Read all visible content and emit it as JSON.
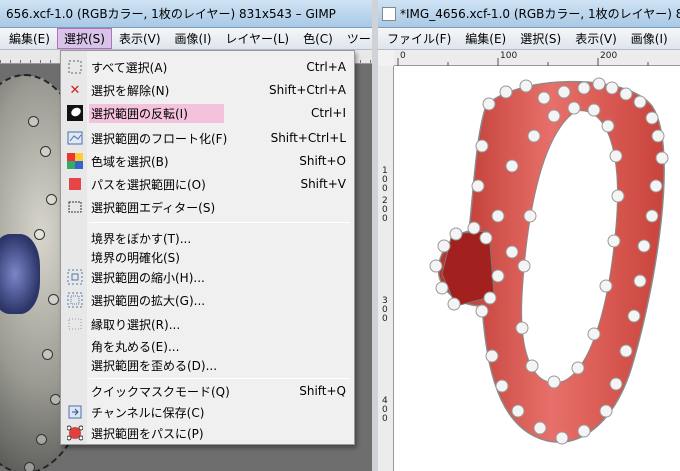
{
  "left_window": {
    "title": "656.xcf-1.0 (RGBカラー, 1枚のレイヤー) 831x543 – GIMP",
    "menubar": [
      "編集(E)",
      "選択(S)",
      "表示(V)",
      "画像(I)",
      "レイヤー(L)",
      "色(C)",
      "ツー"
    ],
    "active_menu": "選択(S)",
    "dropdown": [
      {
        "label": "すべて選択(A)",
        "shortcut": "Ctrl+A",
        "icon": "select-all-icon"
      },
      {
        "label": "選択を解除(N)",
        "shortcut": "Shift+Ctrl+A",
        "icon": "select-none-icon"
      },
      {
        "label": "選択範囲の反転(I)",
        "shortcut": "Ctrl+I",
        "icon": "invert-selection-icon",
        "highlighted": true
      },
      {
        "label": "選択範囲のフロート化(F)",
        "shortcut": "Shift+Ctrl+L",
        "icon": "float-selection-icon"
      },
      {
        "label": "色域を選択(B)",
        "shortcut": "Shift+O",
        "icon": "select-by-color-icon"
      },
      {
        "label": "パスを選択範囲に(O)",
        "shortcut": "Shift+V",
        "icon": "path-to-selection-icon"
      },
      {
        "label": "選択範囲エディター(S)",
        "shortcut": "",
        "icon": "selection-editor-icon"
      },
      {
        "label": "境界をぼかす(T)...",
        "shortcut": "",
        "icon": ""
      },
      {
        "label": "境界の明確化(S)",
        "shortcut": "",
        "icon": ""
      },
      {
        "label": "選択範囲の縮小(H)...",
        "shortcut": "",
        "icon": "shrink-selection-icon"
      },
      {
        "label": "選択範囲の拡大(G)...",
        "shortcut": "",
        "icon": "grow-selection-icon"
      },
      {
        "label": "縁取り選択(R)...",
        "shortcut": "",
        "icon": "border-selection-icon"
      },
      {
        "label": "角を丸める(E)...",
        "shortcut": "",
        "icon": ""
      },
      {
        "label": "選択範囲を歪める(D)...",
        "shortcut": "",
        "icon": ""
      },
      {
        "label": "クイックマスクモード(Q)",
        "shortcut": "Shift+Q",
        "icon": ""
      },
      {
        "label": "チャンネルに保存(C)",
        "shortcut": "",
        "icon": "save-to-channel-icon"
      },
      {
        "label": "選択範囲をパスに(P)",
        "shortcut": "",
        "icon": "selection-to-path-icon"
      }
    ]
  },
  "right_window": {
    "title": "*IMG_4656.xcf-1.0 (RGBカラー, 1枚のレイヤー) 8",
    "menubar": [
      "ファイル(F)",
      "編集(E)",
      "選択(S)",
      "表示(V)",
      "画像(I)"
    ],
    "ruler_h": [
      "0",
      "100",
      "200"
    ],
    "ruler_v": [
      "1",
      "0",
      "0",
      "2",
      "0",
      "0",
      "3",
      "0",
      "0",
      "4",
      "0",
      "0"
    ]
  },
  "colors": {
    "ring_red": "#d9534a",
    "highlight": "#f4c2dc",
    "menu_active_border": "#b36fb8"
  }
}
